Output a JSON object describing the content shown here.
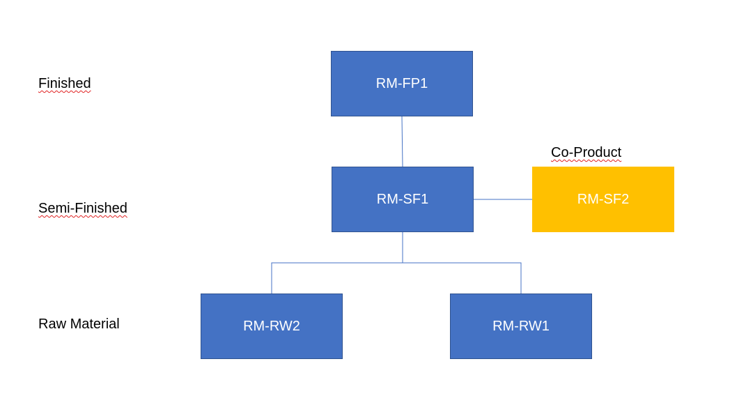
{
  "levels": {
    "finished": "Finished",
    "semi_finished": "Semi-Finished",
    "raw_material": "Raw Material"
  },
  "annotations": {
    "co_product": "Co-Product"
  },
  "nodes": {
    "fp1": "RM-FP1",
    "sf1": "RM-SF1",
    "sf2": "RM-SF2",
    "rw2": "RM-RW2",
    "rw1": "RM-RW1"
  },
  "colors": {
    "node": "#4472c4",
    "co_product_node": "#ffc000",
    "connector": "#4472c4"
  }
}
